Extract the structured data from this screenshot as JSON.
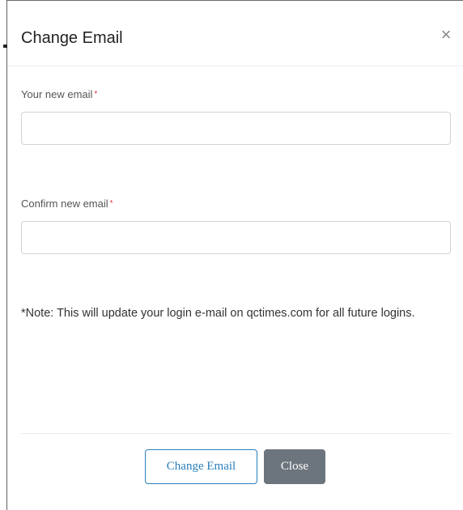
{
  "modal": {
    "title": "Change Email",
    "close_symbol": "×"
  },
  "fields": {
    "new_email": {
      "label": "Your new email",
      "required_marker": "*",
      "value": ""
    },
    "confirm_email": {
      "label": "Confirm new email",
      "required_marker": "*",
      "value": ""
    }
  },
  "note": "*Note: This will update your login e-mail on qctimes.com for all future logins.",
  "footer": {
    "change_label": "Change Email",
    "close_label": "Close"
  },
  "colors": {
    "primary": "#2a7fba",
    "secondary": "#6c757d",
    "required": "#dc3545"
  }
}
